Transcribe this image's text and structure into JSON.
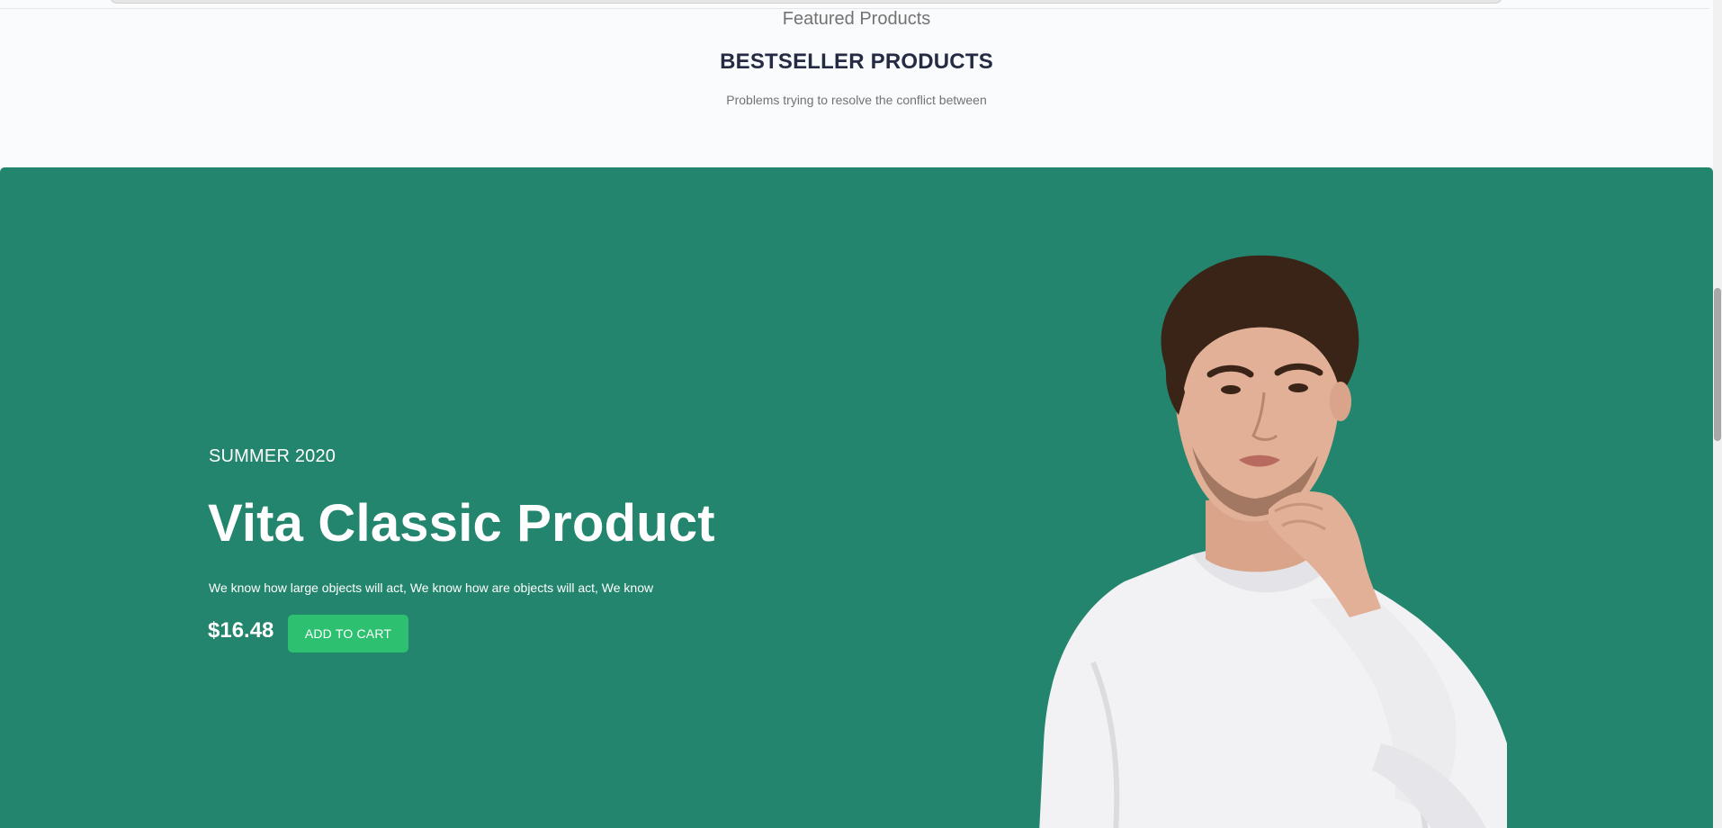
{
  "featured": {
    "label": "Featured Products",
    "title": "BESTSELLER PRODUCTS",
    "subtitle": "Problems trying to resolve the conflict between"
  },
  "hero": {
    "season": "SUMMER 2020",
    "title": "Vita Classic Product",
    "description": "We know how large objects will act, We know how are objects will act, We know",
    "price": "$16.48",
    "cta_label": "ADD TO CART",
    "background_color": "#23856d",
    "cta_color": "#2dc071",
    "image_alt": "Man in white sweater"
  }
}
